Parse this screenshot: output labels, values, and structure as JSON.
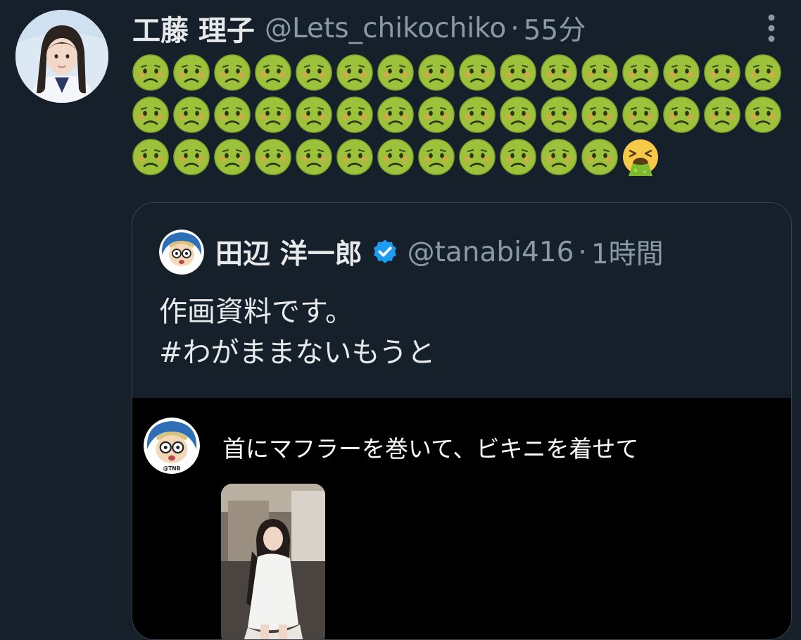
{
  "tweet": {
    "author_name": "工藤 理子",
    "author_handle": "@Lets_chikochiko",
    "separator": "·",
    "time": "55分",
    "emojis": {
      "nauseated_face_count": 44,
      "vomiting_face_count": 1,
      "icons": [
        "nauseated-face-icon",
        "vomiting-face-icon"
      ]
    }
  },
  "quoted_tweet": {
    "author_name": "田辺 洋一郎",
    "verified": true,
    "author_handle": "@tanabi416",
    "separator": "·",
    "time": "1時間",
    "text_lines": [
      "作画資料です。",
      "#わがままないもうと"
    ],
    "media": {
      "caption": "首にマフラーを巻いて、ビキニを着せて",
      "avatar_label": "@TNB"
    }
  },
  "colors": {
    "background": "#15202b",
    "media_background": "#000000",
    "text_primary": "#e7e9ea",
    "text_secondary": "#8b98a5",
    "verified_blue": "#1d9bf0",
    "border": "#38444d",
    "emoji_green": "#9cc23c"
  }
}
